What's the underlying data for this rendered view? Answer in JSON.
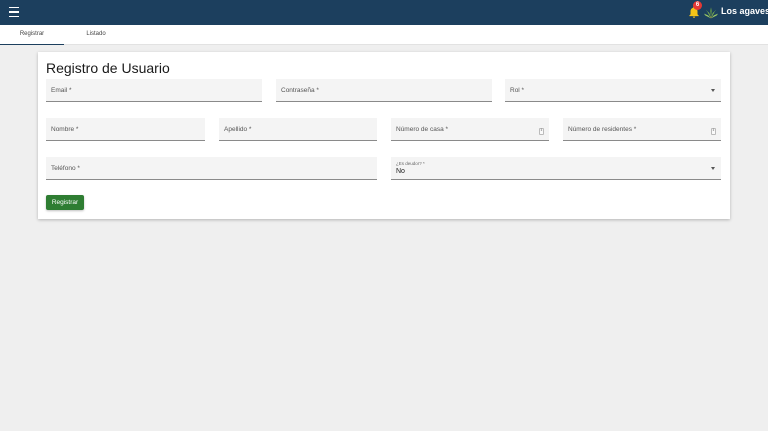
{
  "header": {
    "notification_count": "6",
    "brand_name": "Los agaves"
  },
  "tabs": [
    {
      "label": "Registrar"
    },
    {
      "label": "Listado"
    }
  ],
  "form": {
    "title": "Registro de Usuario",
    "email_label": "Email *",
    "password_label": "Contraseña *",
    "role_label": "Rol *",
    "first_name_label": "Nombre *",
    "last_name_label": "Apellido *",
    "house_number_label": "Número de casa *",
    "residents_label": "Número de residentes *",
    "phone_label": "Teléfono *",
    "debtor_label": "¿Es deudor? *",
    "debtor_value": "No",
    "submit_label": "Registrar"
  }
}
